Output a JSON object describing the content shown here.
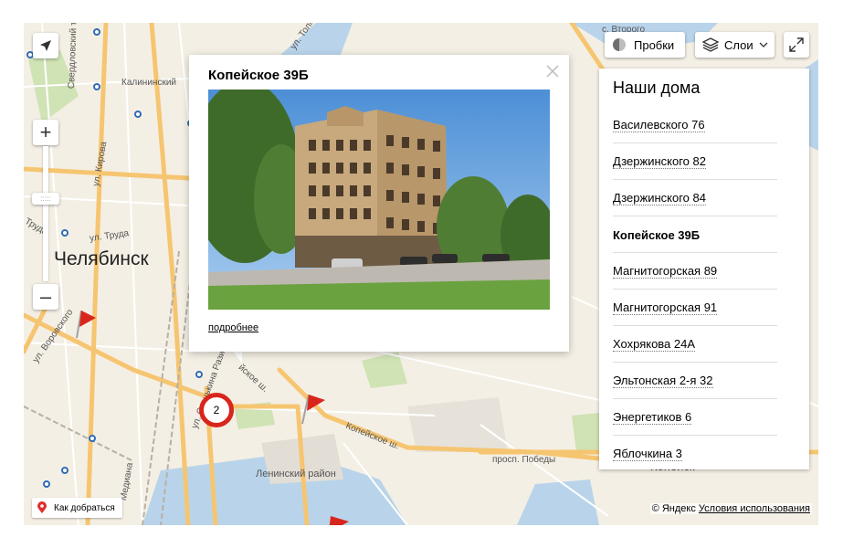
{
  "map": {
    "city_label": "Челябинск",
    "district_label": "Ленинский район",
    "kopeysk_label": "Копейск",
    "street_labels": {
      "kalininsky": "Калининский",
      "kirova": "ул. Кирова",
      "truda_left": "Труда",
      "truda": "ул. Труда",
      "vorovskogo": "ул. Воровского",
      "sverdl": "Свердловский тракт",
      "tolmachev": "ул. Толмачёва",
      "kopeyskoe_sh": "Копейское ш.",
      "kopeyskoe_sh2": "йское ш.",
      "pobedy": "просп. Победы",
      "vtorogo": "с. Второго",
      "razina": "ул. Стенькина Разина",
      "mediana": "Медиана"
    },
    "cluster_count": "2"
  },
  "controls": {
    "traffic_label": "Пробки",
    "layers_label": "Слои",
    "zoom_in": "+",
    "zoom_out": "–",
    "route_label": "Как добраться"
  },
  "balloon": {
    "title": "Копейское 39Б",
    "more_link": "подробнее"
  },
  "panel": {
    "title": "Наши дома",
    "items": [
      "Василевского 76",
      "Дзержинского 82",
      "Дзержинского 84",
      "Копейское 39Б",
      "Магнитогорская 89",
      "Магнитогорская 91",
      "Хохрякова 24А",
      "Эльтонская 2-я 32",
      "Энергетиков 6",
      "Яблочкина 3"
    ],
    "active_index": 3
  },
  "footer": {
    "copyright": "© Яндекс",
    "terms_link": "Условия использования"
  },
  "colors": {
    "marker_red": "#d8261c",
    "road_orange": "#f6c571",
    "water": "#b9d4ea",
    "park": "#cfe3b5"
  }
}
